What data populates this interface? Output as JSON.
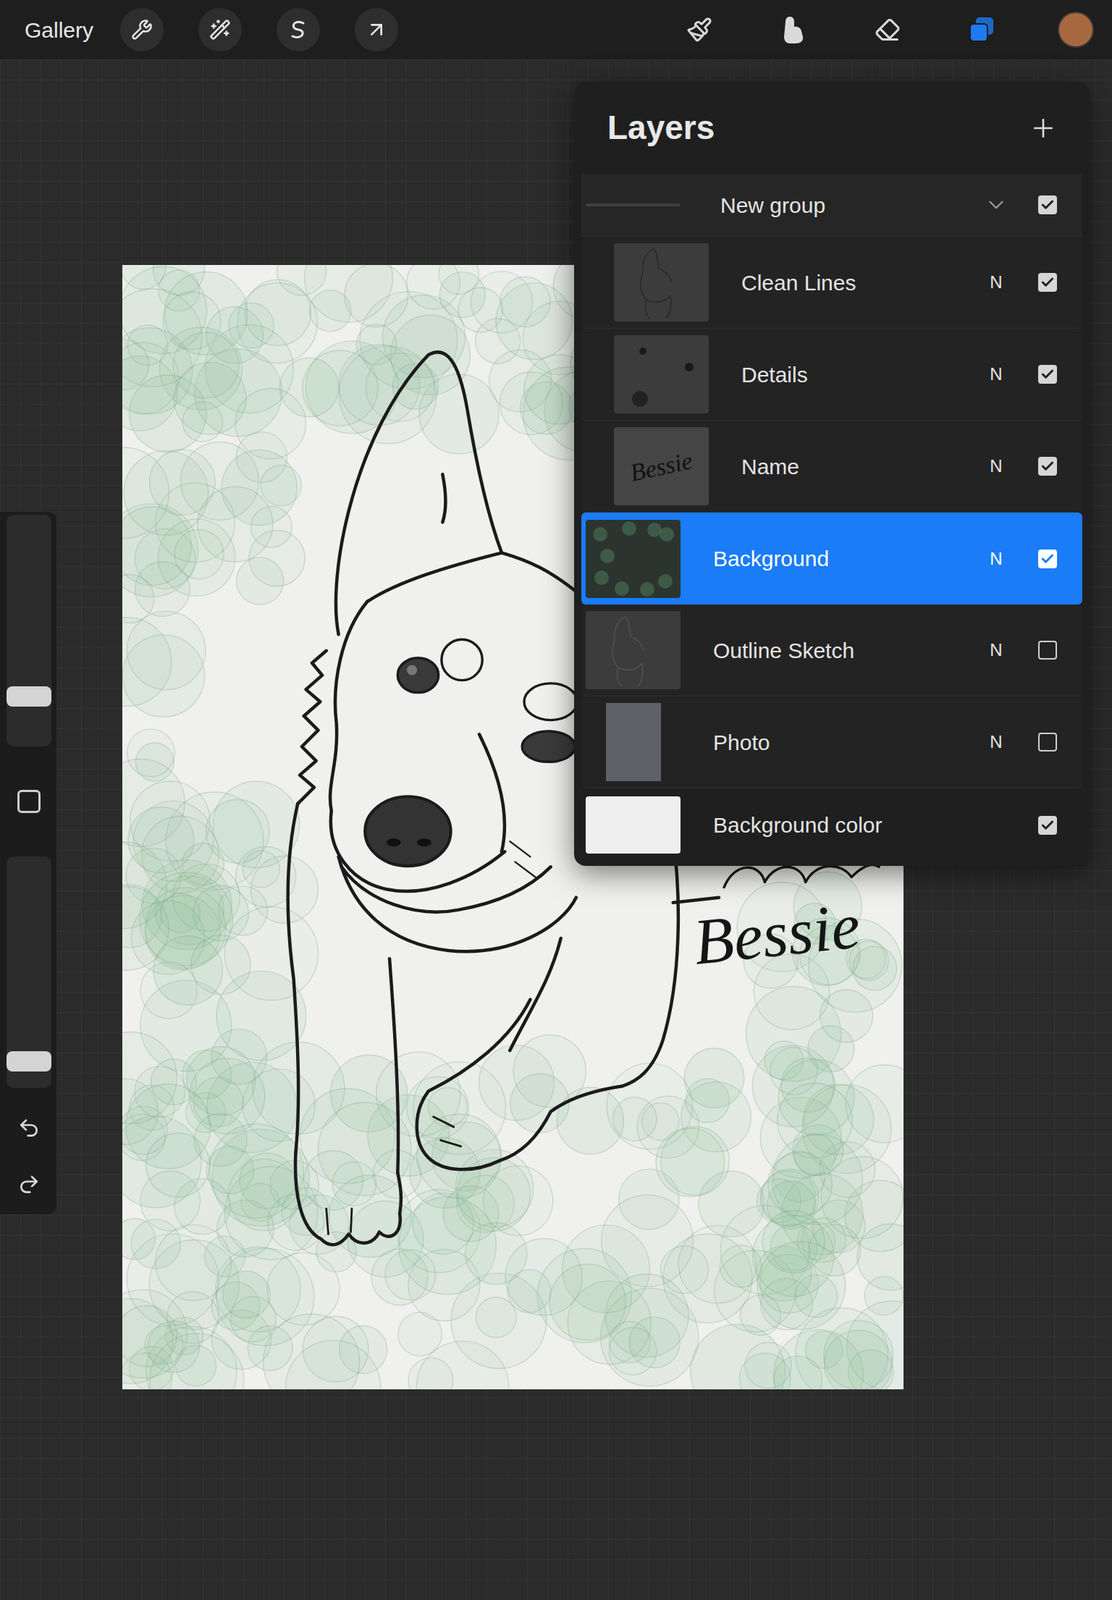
{
  "toolbar": {
    "gallery": "Gallery",
    "right_tools": [
      {
        "kind": "brush",
        "selected": false
      },
      {
        "kind": "smudge",
        "selected": false
      },
      {
        "kind": "eraser",
        "selected": false
      },
      {
        "kind": "layers",
        "selected": true
      }
    ],
    "color": "#a8683f"
  },
  "sidebar": {
    "sliders": [
      {
        "kind": "brush-size",
        "level": 0.19
      },
      {
        "kind": "opacity",
        "level": 0.08
      }
    ]
  },
  "layers_panel": {
    "title": "Layers",
    "layers": [
      {
        "kind": "group",
        "name": "New group",
        "expanded": true,
        "visible": true,
        "selected": false
      },
      {
        "kind": "layer",
        "name": "Clean Lines",
        "blend": "N",
        "visible": true,
        "selected": false,
        "in_group": true,
        "thumb": "lines"
      },
      {
        "kind": "layer",
        "name": "Details",
        "blend": "N",
        "visible": true,
        "selected": false,
        "in_group": true,
        "thumb": "dots"
      },
      {
        "kind": "layer",
        "name": "Name",
        "blend": "N",
        "visible": true,
        "selected": false,
        "in_group": true,
        "thumb": "text",
        "thumb_text": "Bessie"
      },
      {
        "kind": "layer",
        "name": "Background",
        "blend": "N",
        "visible": true,
        "selected": true,
        "in_group": false,
        "thumb": "green"
      },
      {
        "kind": "layer",
        "name": "Outline Sketch",
        "blend": "N",
        "visible": false,
        "selected": false,
        "in_group": false,
        "thumb": "sketch"
      },
      {
        "kind": "layer",
        "name": "Photo",
        "blend": "N",
        "visible": false,
        "selected": false,
        "in_group": false,
        "thumb": "photo"
      },
      {
        "kind": "background-color",
        "name": "Background color",
        "visible": true,
        "selected": false
      }
    ]
  },
  "artwork": {
    "name": "Bessie"
  }
}
